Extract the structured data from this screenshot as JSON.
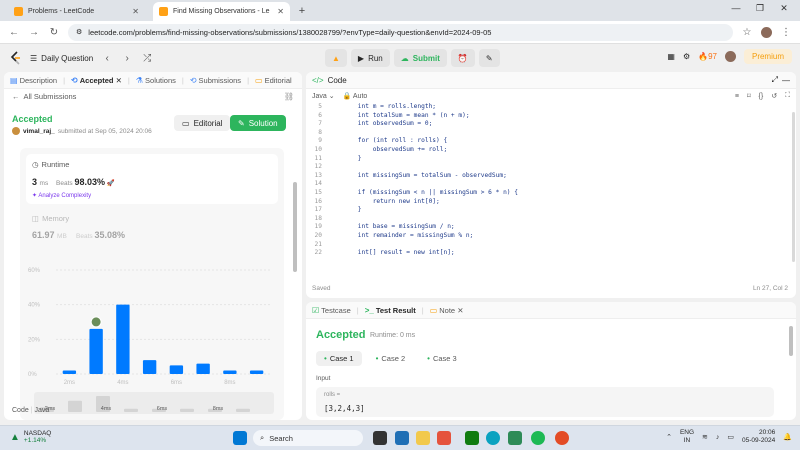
{
  "browser": {
    "tabs": [
      {
        "title": "Problems - LeetCode",
        "active": false
      },
      {
        "title": "Find Missing Observations - Le",
        "active": true
      }
    ],
    "url": "leetcode.com/problems/find-missing-observations/submissions/1380028799/?envType=daily-question&envId=2024-09-05"
  },
  "lcnav": {
    "daily_question": "Daily Question",
    "run": "Run",
    "submit": "Submit",
    "streak": "97",
    "premium": "Premium"
  },
  "leftpanel": {
    "tabs": [
      "Description",
      "Accepted",
      "Solutions",
      "Submissions",
      "Editorial"
    ],
    "all_submissions": "All Submissions",
    "status": "Accepted",
    "user": "vimal_raj_",
    "submitted_at": "submitted at Sep 05, 2024 20:06",
    "editorial_btn": "Editorial",
    "solution_btn": "Solution",
    "runtime": {
      "label": "Runtime",
      "value": "3",
      "unit": "ms",
      "beats_label": "Beats",
      "beats": "98.03%",
      "analyze": "Analyze Complexity"
    },
    "memory": {
      "label": "Memory",
      "value": "61.97",
      "unit": "MB",
      "beats_label": "Beats",
      "beats": "35.08%"
    },
    "footer_code": "Code",
    "footer_lang": "Java"
  },
  "chart_data": {
    "type": "bar",
    "yticks": [
      "60%",
      "40%",
      "20%",
      "0%"
    ],
    "ylim": [
      0,
      60
    ],
    "xticks": [
      "2ms",
      "4ms",
      "6ms",
      "8ms"
    ],
    "values": [
      2,
      26,
      40,
      8,
      5,
      6,
      2,
      2
    ],
    "highlight_index": 1,
    "mini_ticks": [
      "2ms",
      "4ms",
      "6ms",
      "8ms"
    ]
  },
  "codepanel": {
    "title": "Code",
    "lang": "Java",
    "auto": "Auto",
    "lines": [
      {
        "n": "5",
        "t": "        int m = rolls.length;"
      },
      {
        "n": "6",
        "t": "        int totalSum = mean * (n + m);"
      },
      {
        "n": "7",
        "t": "        int observedSum = 0;"
      },
      {
        "n": "8",
        "t": ""
      },
      {
        "n": "9",
        "t": "        for (int roll : rolls) {"
      },
      {
        "n": "10",
        "t": "            observedSum += roll;"
      },
      {
        "n": "11",
        "t": "        }"
      },
      {
        "n": "12",
        "t": ""
      },
      {
        "n": "13",
        "t": "        int missingSum = totalSum - observedSum;"
      },
      {
        "n": "14",
        "t": ""
      },
      {
        "n": "15",
        "t": "        if (missingSum < n || missingSum > 6 * n) {"
      },
      {
        "n": "16",
        "t": "            return new int[0];"
      },
      {
        "n": "17",
        "t": "        }"
      },
      {
        "n": "18",
        "t": ""
      },
      {
        "n": "19",
        "t": "        int base = missingSum / n;"
      },
      {
        "n": "20",
        "t": "        int remainder = missingSum % n;"
      },
      {
        "n": "21",
        "t": ""
      },
      {
        "n": "22",
        "t": "        int[] result = new int[n];"
      }
    ],
    "saved": "Saved",
    "lncol": "Ln 27, Col 2"
  },
  "resultpanel": {
    "tabs": [
      "Testcase",
      "Test Result",
      "Note"
    ],
    "status": "Accepted",
    "runtime": "Runtime: 0 ms",
    "cases": [
      "Case 1",
      "Case 2",
      "Case 3"
    ],
    "input_label": "Input",
    "var_name": "rolls =",
    "var_value": "[3,2,4,3]"
  },
  "taskbar": {
    "nasdaq_name": "NASDAQ",
    "nasdaq_change": "+1.14%",
    "search": "Search",
    "lang1": "ENG",
    "lang2": "IN",
    "time": "20:06",
    "date": "05-09-2024"
  }
}
